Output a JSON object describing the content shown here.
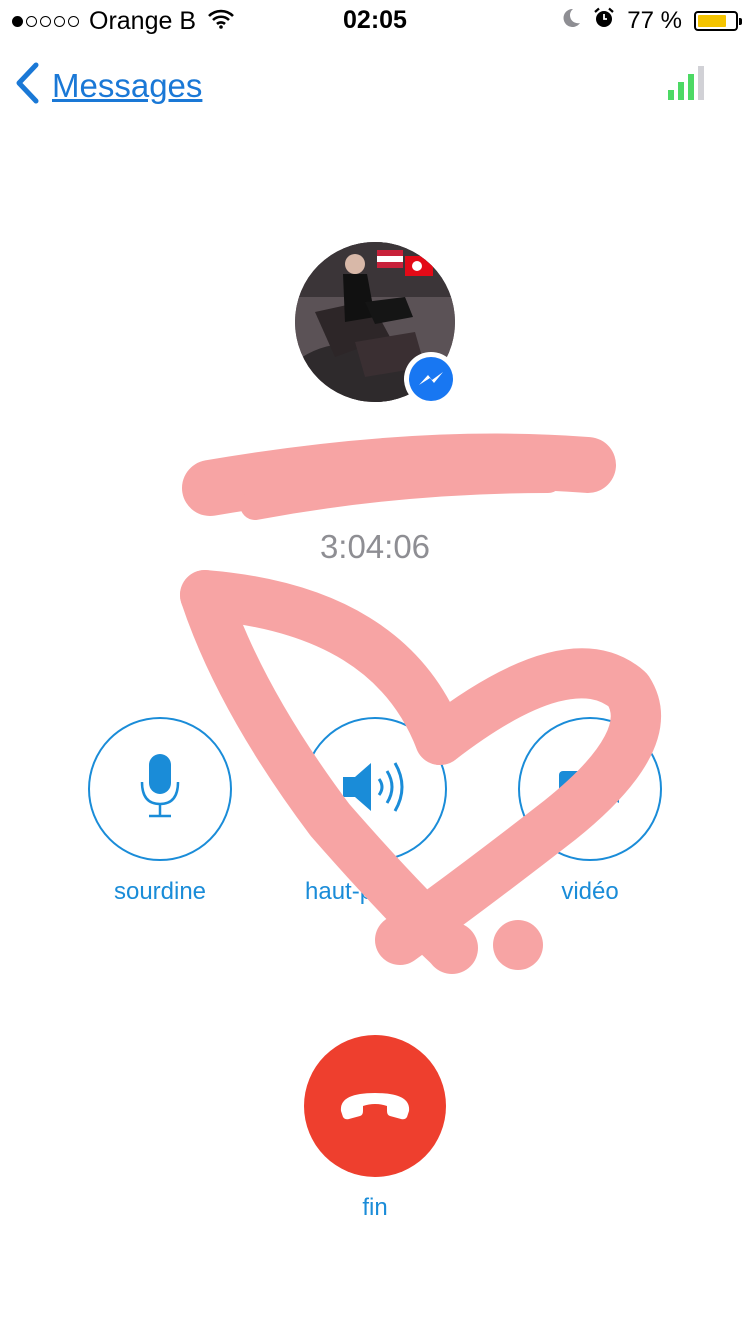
{
  "status_bar": {
    "signal_dots": [
      true,
      false,
      false,
      false,
      false
    ],
    "carrier": "Orange B",
    "time": "02:05",
    "battery_text": "77 %",
    "battery_level": 0.77,
    "icons": [
      "wifi-icon",
      "moon-icon",
      "alarm-icon",
      "battery-icon"
    ]
  },
  "nav": {
    "back_label": "Messages",
    "connection_quality_bars": 3,
    "connection_quality_total": 4
  },
  "call": {
    "caller_name": "",
    "duration": "3:04:06"
  },
  "controls": [
    {
      "label": "sourdine",
      "icon": "microphone-icon"
    },
    {
      "label": "haut-p",
      "icon": "speaker-icon"
    },
    {
      "label": "vidéo",
      "icon": "video-camera-icon"
    }
  ],
  "end_call": {
    "label": "fin",
    "icon": "hang-up-icon"
  },
  "colors": {
    "accent": "#1a8cd8",
    "link": "#1a78d6",
    "end_call": "#ee3f2e",
    "battery": "#f5c400",
    "signal": "#4cd964",
    "scribble": "#f7a4a4",
    "messenger": "#1877f2"
  }
}
